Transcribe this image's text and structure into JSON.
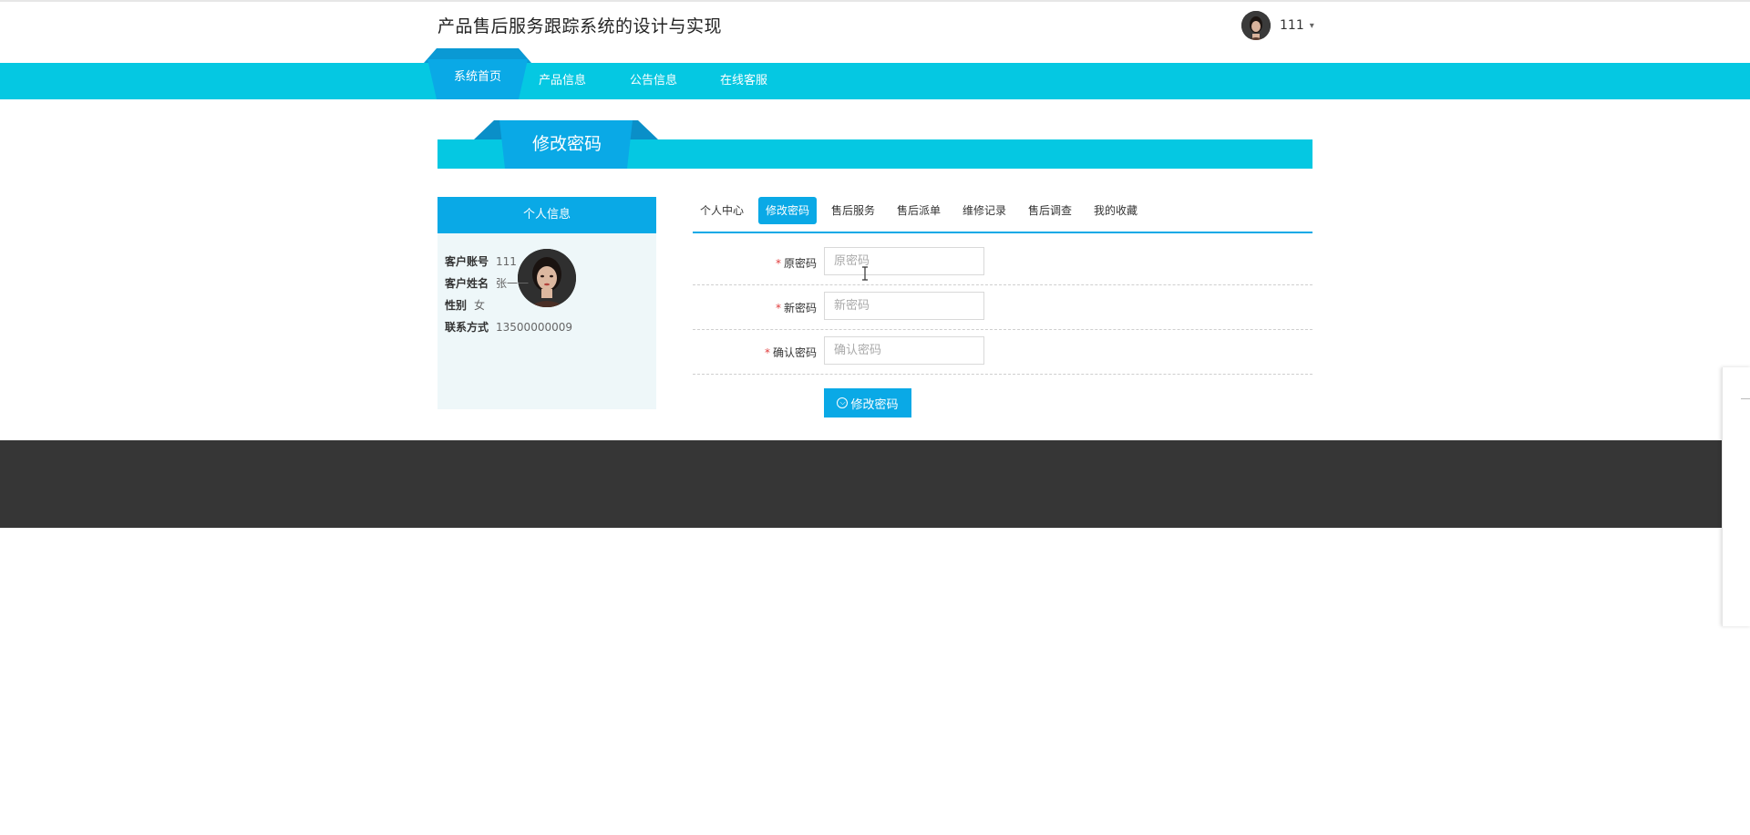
{
  "header": {
    "site_title": "产品售后服务跟踪系统的设计与实现",
    "user_name": "111",
    "user_caret": "▾"
  },
  "nav": {
    "items": [
      {
        "label": "系统首页",
        "active": true
      },
      {
        "label": "产品信息",
        "active": false
      },
      {
        "label": "公告信息",
        "active": false
      },
      {
        "label": "在线客服",
        "active": false
      }
    ]
  },
  "section": {
    "title": "修改密码"
  },
  "profile": {
    "header": "个人信息",
    "fields": [
      {
        "label": "客户账号",
        "value": "111"
      },
      {
        "label": "客户姓名",
        "value": "张一一"
      },
      {
        "label": "性别",
        "value": "女"
      },
      {
        "label": "联系方式",
        "value": "13500000009"
      }
    ]
  },
  "tabs": [
    {
      "label": "个人中心",
      "active": false
    },
    {
      "label": "修改密码",
      "active": true
    },
    {
      "label": "售后服务",
      "active": false
    },
    {
      "label": "售后派单",
      "active": false
    },
    {
      "label": "维修记录",
      "active": false
    },
    {
      "label": "售后调查",
      "active": false
    },
    {
      "label": "我的收藏",
      "active": false
    }
  ],
  "form": {
    "required_mark": "*",
    "fields": [
      {
        "label": "原密码",
        "placeholder": "原密码",
        "value": ""
      },
      {
        "label": "新密码",
        "placeholder": "新密码",
        "value": ""
      },
      {
        "label": "确认密码",
        "placeholder": "确认密码",
        "value": ""
      }
    ],
    "submit_label": "修改密码",
    "submit_icon": "⌵"
  },
  "colors": {
    "accent": "#0aa9e6",
    "nav_bar": "#05c8e2",
    "footer": "#363636",
    "required": "#e03c3c"
  }
}
